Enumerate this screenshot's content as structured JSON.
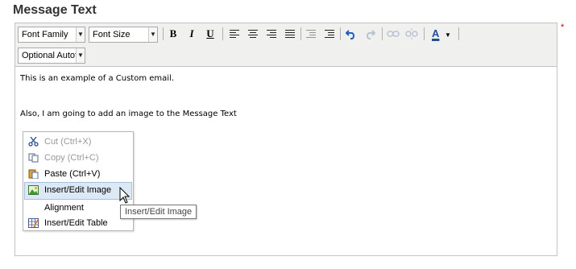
{
  "section": {
    "title": "Message Text",
    "required_marker": "*"
  },
  "toolbar": {
    "font_family": "Font Family",
    "font_size": "Font Size",
    "optional_autofill": "Optional Autof",
    "bold_glyph": "B",
    "italic_glyph": "I",
    "underline_glyph": "U",
    "font_color_glyph": "A",
    "font_color_accent": "#1f4e9e",
    "undo_color": "#2060c0",
    "disabled_color": "#b8c4d4"
  },
  "editor": {
    "line1": "This is an example of a Custom email.",
    "line2": "Also, I am going to add an image to the Message Text"
  },
  "context_menu": {
    "items": [
      {
        "label": "Cut (Ctrl+X)",
        "icon": "scissors-icon",
        "disabled": true
      },
      {
        "label": "Copy (Ctrl+C)",
        "icon": "copy-icon",
        "disabled": true
      },
      {
        "label": "Paste (Ctrl+V)",
        "icon": "paste-icon",
        "disabled": false
      },
      {
        "label": "Insert/Edit Image",
        "icon": "image-icon",
        "disabled": false
      },
      {
        "label": "Alignment",
        "icon": "",
        "disabled": false
      },
      {
        "label": "Insert/Edit Table",
        "icon": "table-icon",
        "disabled": false
      }
    ],
    "hover_bg": "#dde8f5"
  },
  "tooltip": {
    "text": "Insert/Edit Image"
  }
}
